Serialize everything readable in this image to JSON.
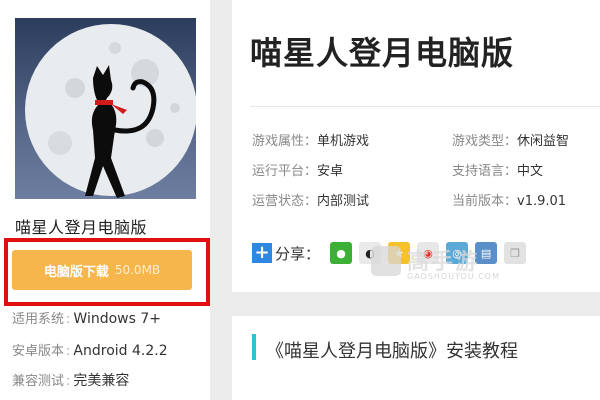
{
  "left": {
    "game_name": "喵星人登月电脑版",
    "download_label": "电脑版下载",
    "download_size": "50.0MB",
    "info": [
      {
        "key": "适用系统",
        "value": "Windows 7+"
      },
      {
        "key": "安卓版本",
        "value": "Android 4.2.2"
      },
      {
        "key": "兼容测试",
        "value": "完美兼容"
      }
    ]
  },
  "main": {
    "title": "喵星人登月电脑版",
    "attributes": [
      {
        "key": "游戏属性",
        "value": "单机游戏"
      },
      {
        "key": "游戏类型",
        "value": "休闲益智"
      },
      {
        "key": "运行平台",
        "value": "安卓"
      },
      {
        "key": "支持语言",
        "value": "中文"
      },
      {
        "key": "运营状态",
        "value": "内部测试"
      },
      {
        "key": "当前版本",
        "value": "v1.9.01"
      }
    ],
    "share_label": "分享：",
    "share_icons": [
      "wechat-icon",
      "qq-icon",
      "qzone-icon",
      "weibo-icon",
      "tencent-weibo-icon",
      "print-icon",
      "copy-icon"
    ],
    "watermark_text": "高手游",
    "watermark_sub": "GAOSHOUYOU.COM"
  },
  "tutorial": {
    "title": "《喵星人登月电脑版》安装教程"
  },
  "colors": {
    "download_button": "#f7b64b",
    "highlight_frame": "#e01010",
    "accent_bar": "#2cc3d5",
    "share_plus": "#2e87e0"
  }
}
